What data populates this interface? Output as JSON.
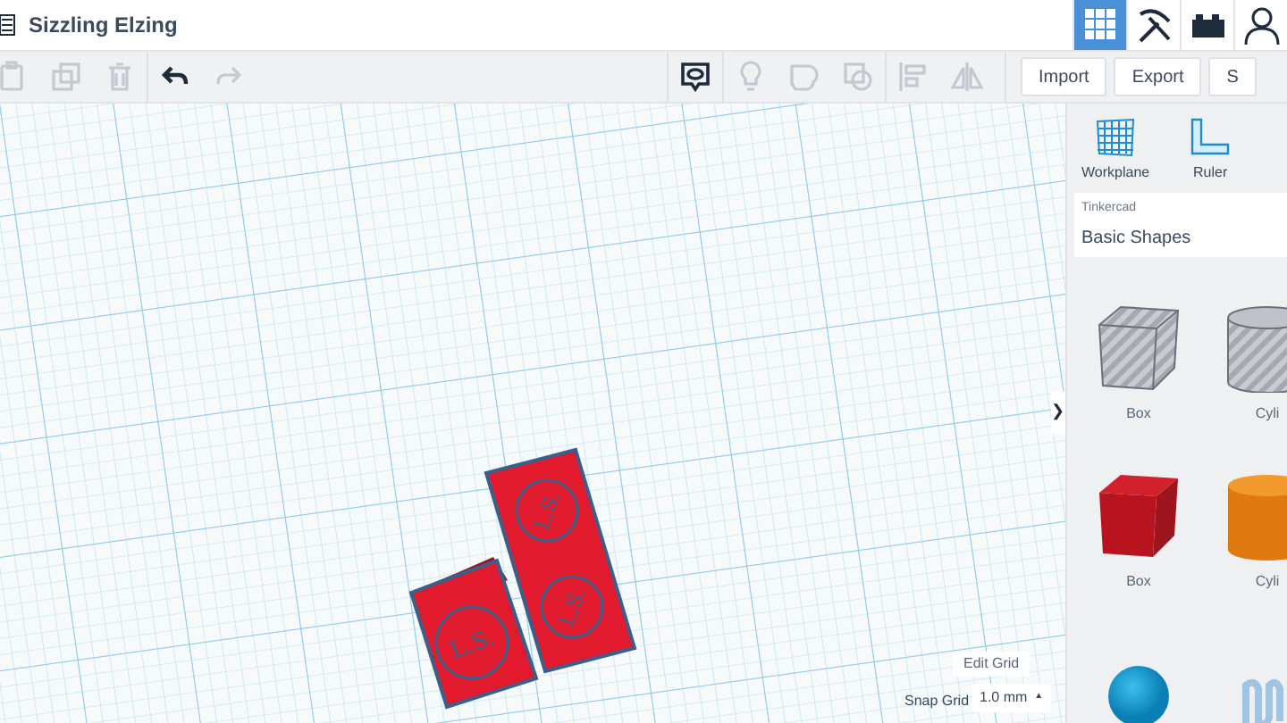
{
  "title": "Sizzling Elzing",
  "views": [
    {
      "kind": "grid",
      "selected": true
    },
    {
      "kind": "pickaxe",
      "selected": false
    },
    {
      "kind": "brick",
      "selected": false
    },
    {
      "kind": "user",
      "selected": false
    }
  ],
  "tools": [
    {
      "kind": "paste",
      "disabled": true
    },
    {
      "kind": "duplicate",
      "disabled": true
    },
    {
      "kind": "trash",
      "disabled": true
    },
    {
      "kind": "undo",
      "disabled": false
    },
    {
      "kind": "redo",
      "disabled": true
    },
    {
      "kind": "notes",
      "disabled": false
    },
    {
      "kind": "bulb",
      "disabled": true
    },
    {
      "kind": "group",
      "disabled": true
    },
    {
      "kind": "ungroup",
      "disabled": true
    },
    {
      "kind": "align",
      "disabled": true
    },
    {
      "kind": "mirror",
      "disabled": true
    }
  ],
  "actions": [
    "Import",
    "Export",
    "S"
  ],
  "model_engravings": [
    "L.S.",
    "L.S.",
    "L.S."
  ],
  "panel": {
    "tools": [
      {
        "kind": "workplane",
        "label": "Workplane"
      },
      {
        "kind": "ruler",
        "label": "Ruler"
      }
    ],
    "library_source": "Tinkercad",
    "library": "Basic Shapes",
    "shapes": [
      {
        "kind": "hole-box",
        "label": "Box"
      },
      {
        "kind": "hole-cylinder",
        "label": "Cyli"
      },
      {
        "kind": "box",
        "label": "Box"
      },
      {
        "kind": "cylinder",
        "label": "Cyli"
      },
      {
        "kind": "sphere"
      },
      {
        "kind": "scribble"
      }
    ]
  },
  "collapse_glyph": "❯",
  "edit_grid": "Edit Grid",
  "snap_grid": {
    "label": "Snap Grid",
    "value": "1.0 mm",
    "glyph": "▲"
  }
}
